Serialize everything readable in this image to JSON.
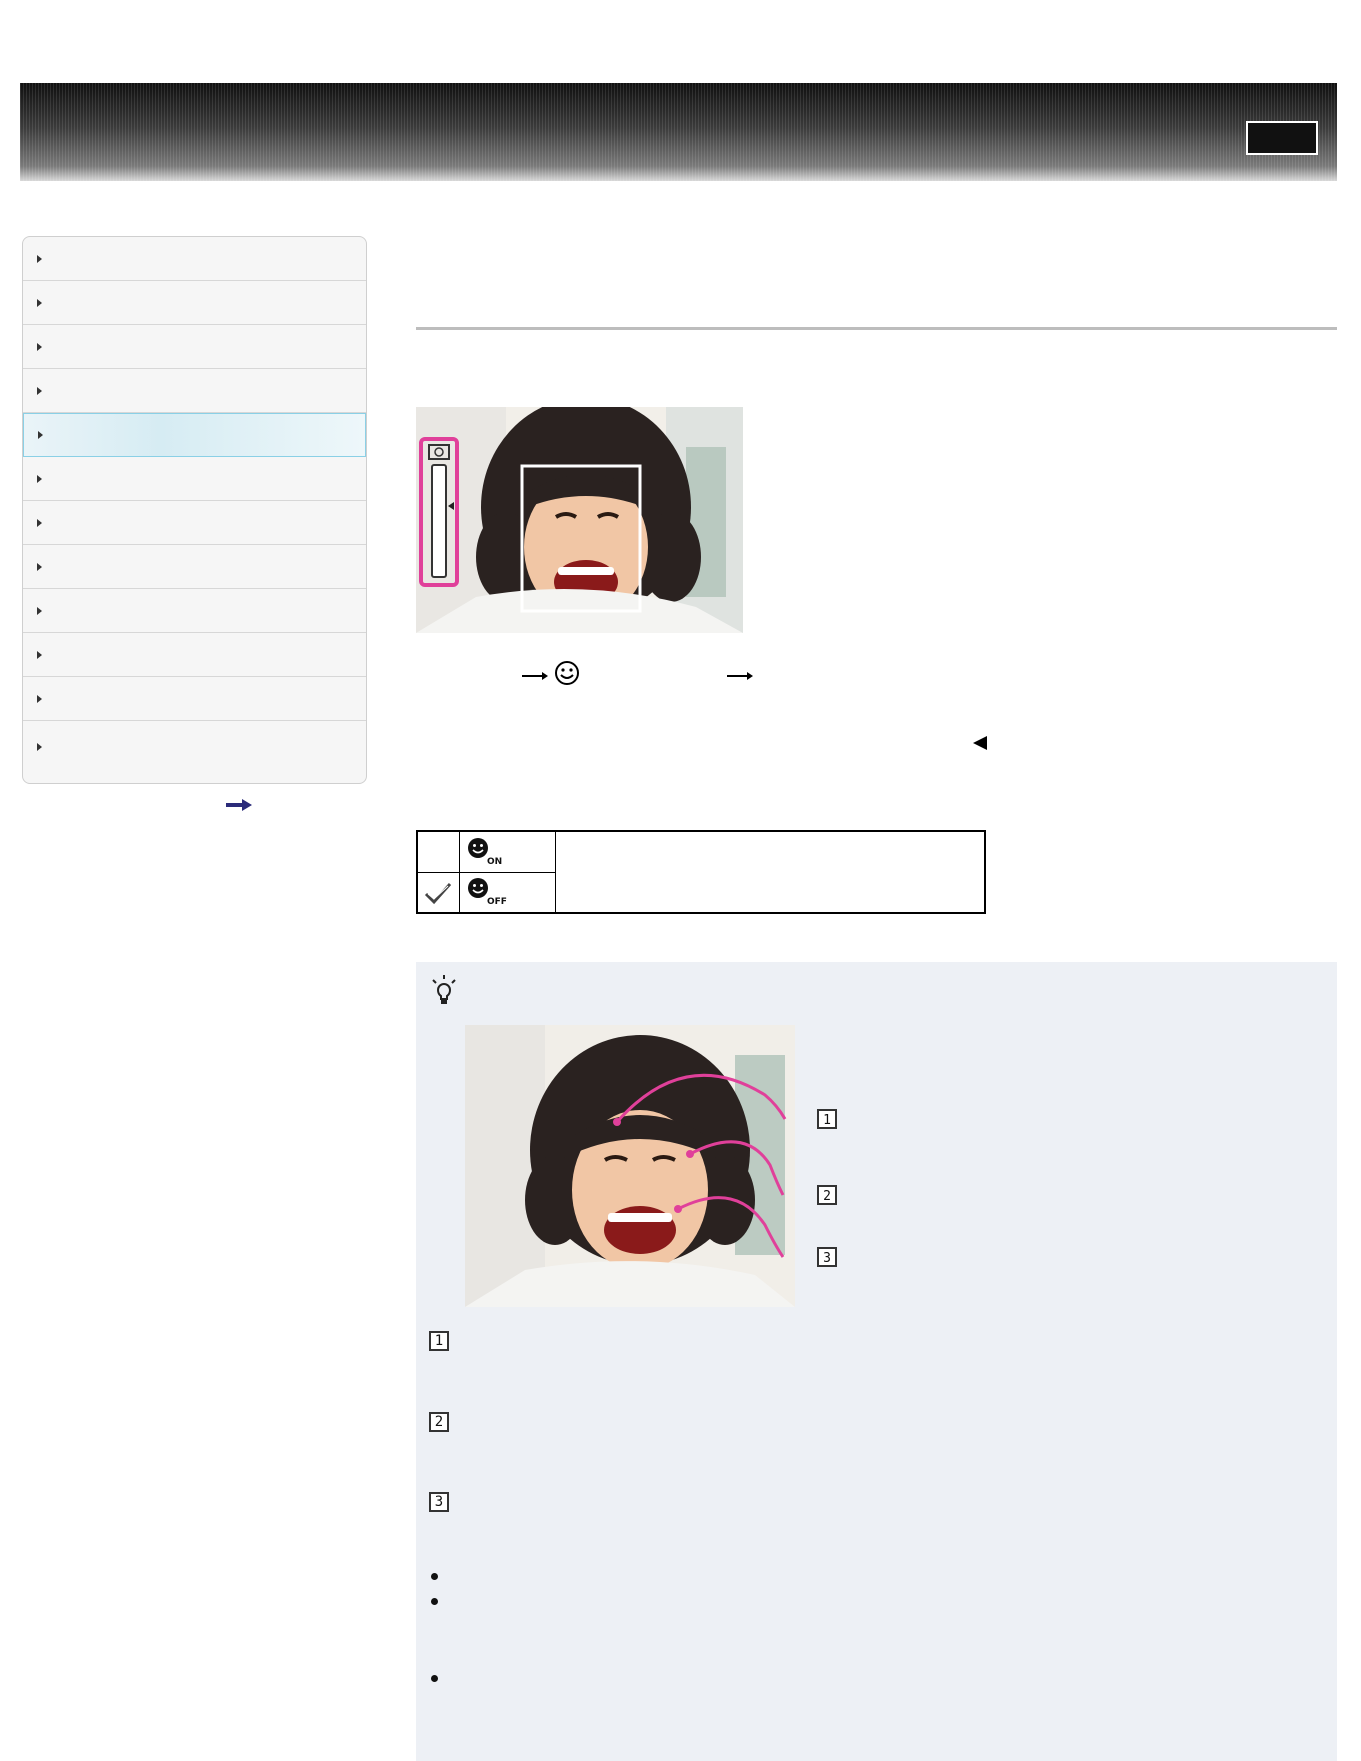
{
  "header": {
    "logo_icon": "banner-stripes",
    "button_icon": "header-button-icon"
  },
  "sidebar": {
    "items": [
      {
        "id": "1"
      },
      {
        "id": "2"
      },
      {
        "id": "3"
      },
      {
        "id": "4"
      },
      {
        "id": "5",
        "active": true
      },
      {
        "id": "6"
      },
      {
        "id": "7"
      },
      {
        "id": "8"
      },
      {
        "id": "9"
      },
      {
        "id": "10"
      },
      {
        "id": "11"
      },
      {
        "id": "12"
      }
    ],
    "more_icon": "arrow-right-icon"
  },
  "main": {
    "sequence_icons": [
      "arrow-right-icon",
      "smile-icon",
      "arrow-right-icon"
    ],
    "options_table": {
      "rows": [
        {
          "icon": "smile-on-icon",
          "sub": "ON",
          "selected": false
        },
        {
          "icon": "smile-off-icon",
          "sub": "OFF",
          "selected": true
        }
      ]
    },
    "hint": {
      "icon": "lightbulb-icon",
      "callouts": [
        "1",
        "2",
        "3"
      ],
      "list_numbers": [
        "1",
        "2",
        "3"
      ]
    }
  },
  "colors": {
    "accent_pink": "#e0409a",
    "sidebar_active": "#d6ecf3",
    "hint_bg": "#edf0f5"
  }
}
